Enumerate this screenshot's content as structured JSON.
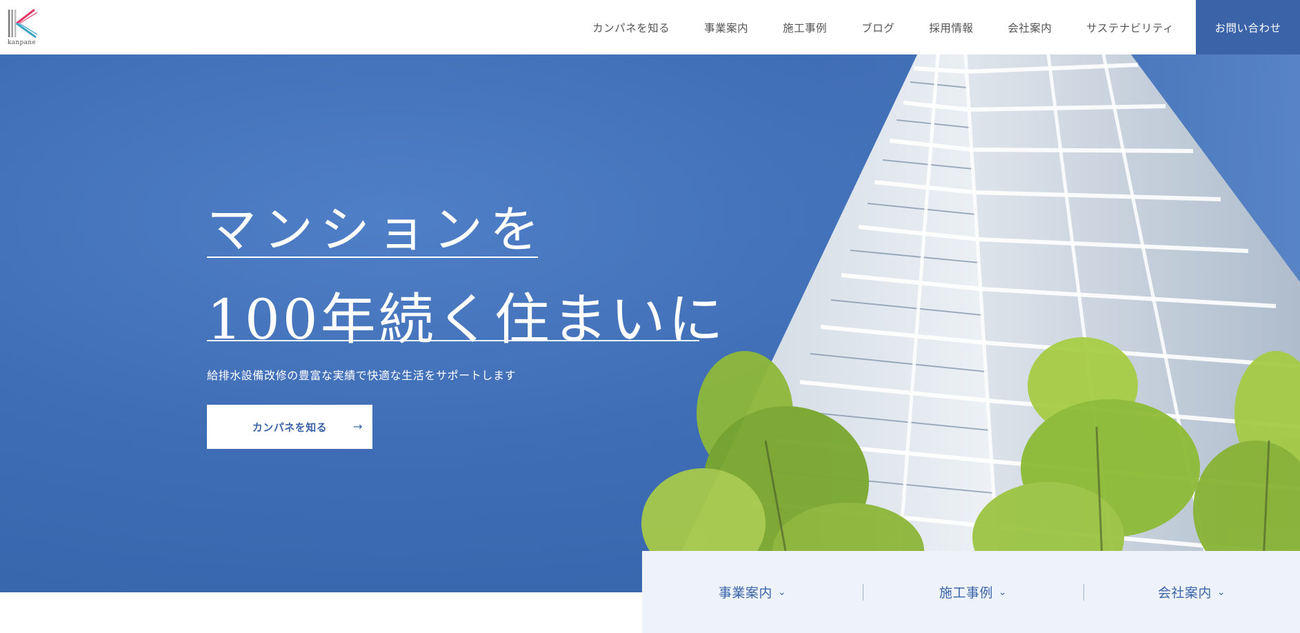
{
  "brand": {
    "name": "kanpane"
  },
  "header": {
    "nav": [
      "カンパネを知る",
      "事業案内",
      "施工事例",
      "ブログ",
      "採用情報",
      "会社案内",
      "サステナビリティ"
    ],
    "cta": "お問い合わせ"
  },
  "hero": {
    "line1": "マンションを",
    "line2": "100年続く住まいに",
    "subtitle": "給排水設備改修の豊富な実績で快適な生活をサポートします",
    "button": "カンパネを知る"
  },
  "subnav": [
    "事業案内",
    "施工事例",
    "会社案内"
  ],
  "colors": {
    "brand": "#3b63a8",
    "hero_bg": "#4a78c0",
    "subnav_bg": "#eef3fb"
  },
  "icons": [
    "arrow-right-icon",
    "chevron-down-icon"
  ]
}
